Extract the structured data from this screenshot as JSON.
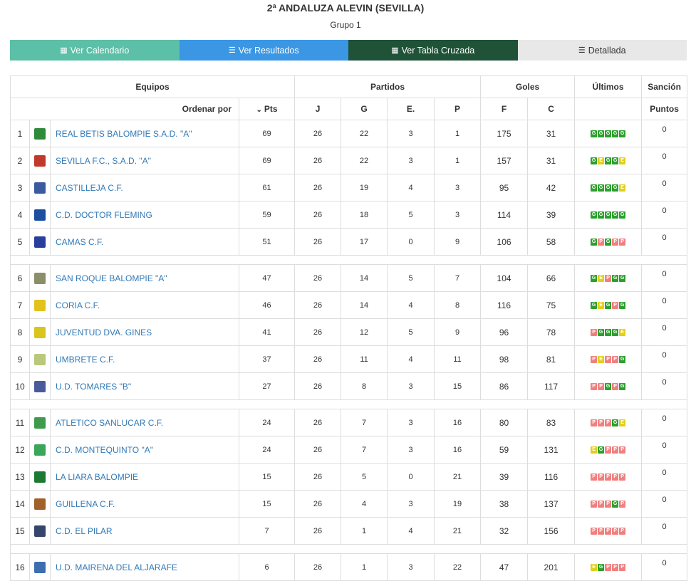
{
  "header": {
    "title": "2ª ANDALUZA ALEVIN (SEVILLA)",
    "subtitle": "Grupo 1"
  },
  "buttons": [
    {
      "label": "Ver Calendario",
      "icon": "calendar-icon",
      "color": "#5cbfa7",
      "text": "#ffffff"
    },
    {
      "label": "Ver Resultados",
      "icon": "list-icon",
      "color": "#3b97e3",
      "text": "#ffffff"
    },
    {
      "label": "Ver Tabla Cruzada",
      "icon": "grid-icon",
      "color": "#1f5237",
      "text": "#ffffff"
    },
    {
      "label": "Detallada",
      "icon": "detail-list-icon",
      "color": "#e8e8e8",
      "text": "#333333"
    }
  ],
  "table": {
    "head1": {
      "equipos": "Equipos",
      "partidos": "Partidos",
      "goles": "Goles",
      "ultimos": "Últimos",
      "sancion": "Sanción"
    },
    "head2": {
      "ordenar": "Ordenar por",
      "pts": "Pts",
      "j": "J",
      "g": "G",
      "e": "E.",
      "p": "P",
      "f": "F",
      "c": "C",
      "puntos": "Puntos"
    },
    "rows": [
      {
        "pos": "1",
        "name": "REAL BETIS BALOMPIE S.A.D. \"A\"",
        "crest": "#2e8b3a",
        "pts": "69",
        "j": "26",
        "g": "22",
        "e": "3",
        "p": "1",
        "f": "175",
        "c": "31",
        "form": [
          "G",
          "G",
          "G",
          "G",
          "G"
        ],
        "sancion": "0"
      },
      {
        "pos": "2",
        "name": "SEVILLA F.C., S.A.D. \"A\"",
        "crest": "#c0392b",
        "pts": "69",
        "j": "26",
        "g": "22",
        "e": "3",
        "p": "1",
        "f": "157",
        "c": "31",
        "form": [
          "G",
          "E",
          "G",
          "G",
          "E"
        ],
        "sancion": "0"
      },
      {
        "pos": "3",
        "name": "CASTILLEJA C.F.",
        "crest": "#3b5aa0",
        "pts": "61",
        "j": "26",
        "g": "19",
        "e": "4",
        "p": "3",
        "f": "95",
        "c": "42",
        "form": [
          "G",
          "G",
          "G",
          "G",
          "E"
        ],
        "sancion": "0"
      },
      {
        "pos": "4",
        "name": "C.D. DOCTOR FLEMING",
        "crest": "#1d4ea0",
        "pts": "59",
        "j": "26",
        "g": "18",
        "e": "5",
        "p": "3",
        "f": "114",
        "c": "39",
        "form": [
          "G",
          "G",
          "G",
          "G",
          "G"
        ],
        "sancion": "0"
      },
      {
        "pos": "5",
        "name": "CAMAS C.F.",
        "crest": "#2a3f9c",
        "pts": "51",
        "j": "26",
        "g": "17",
        "e": "0",
        "p": "9",
        "f": "106",
        "c": "58",
        "form": [
          "G",
          "P",
          "G",
          "P",
          "P"
        ],
        "sancion": "0"
      },
      {
        "sep": true
      },
      {
        "pos": "6",
        "name": "SAN ROQUE BALOMPIE \"A\"",
        "crest": "#8a8f6a",
        "pts": "47",
        "j": "26",
        "g": "14",
        "e": "5",
        "p": "7",
        "f": "104",
        "c": "66",
        "form": [
          "G",
          "E",
          "P",
          "G",
          "G"
        ],
        "sancion": "0"
      },
      {
        "pos": "7",
        "name": "CORIA C.F.",
        "crest": "#e3c21d",
        "pts": "46",
        "j": "26",
        "g": "14",
        "e": "4",
        "p": "8",
        "f": "116",
        "c": "75",
        "form": [
          "G",
          "E",
          "G",
          "P",
          "G"
        ],
        "sancion": "0"
      },
      {
        "pos": "8",
        "name": "JUVENTUD DVA. GINES",
        "crest": "#d9c51b",
        "pts": "41",
        "j": "26",
        "g": "12",
        "e": "5",
        "p": "9",
        "f": "96",
        "c": "78",
        "form": [
          "P",
          "G",
          "G",
          "G",
          "E"
        ],
        "sancion": "0"
      },
      {
        "pos": "9",
        "name": "UMBRETE C.F.",
        "crest": "#b9c87a",
        "pts": "37",
        "j": "26",
        "g": "11",
        "e": "4",
        "p": "11",
        "f": "98",
        "c": "81",
        "form": [
          "P",
          "E",
          "P",
          "P",
          "G"
        ],
        "sancion": "0"
      },
      {
        "pos": "10",
        "name": "U.D. TOMARES \"B\"",
        "crest": "#4a5b9c",
        "pts": "27",
        "j": "26",
        "g": "8",
        "e": "3",
        "p": "15",
        "f": "86",
        "c": "117",
        "form": [
          "P",
          "P",
          "G",
          "P",
          "G"
        ],
        "sancion": "0"
      },
      {
        "sep": true
      },
      {
        "pos": "11",
        "name": "ATLETICO SANLUCAR C.F.",
        "crest": "#3f9a4b",
        "pts": "24",
        "j": "26",
        "g": "7",
        "e": "3",
        "p": "16",
        "f": "80",
        "c": "83",
        "form": [
          "P",
          "P",
          "P",
          "G",
          "E"
        ],
        "sancion": "0"
      },
      {
        "pos": "12",
        "name": "C.D. MONTEQUINTO \"A\"",
        "crest": "#39a659",
        "pts": "24",
        "j": "26",
        "g": "7",
        "e": "3",
        "p": "16",
        "f": "59",
        "c": "131",
        "form": [
          "E",
          "G",
          "P",
          "P",
          "P"
        ],
        "sancion": "0"
      },
      {
        "pos": "13",
        "name": "LA LIARA BALOMPIE",
        "crest": "#1d7a34",
        "pts": "15",
        "j": "26",
        "g": "5",
        "e": "0",
        "p": "21",
        "f": "39",
        "c": "116",
        "form": [
          "P",
          "P",
          "P",
          "P",
          "P"
        ],
        "sancion": "0"
      },
      {
        "pos": "14",
        "name": "GUILLENA C.F.",
        "crest": "#a0622a",
        "pts": "15",
        "j": "26",
        "g": "4",
        "e": "3",
        "p": "19",
        "f": "38",
        "c": "137",
        "form": [
          "P",
          "P",
          "P",
          "G",
          "P"
        ],
        "sancion": "0"
      },
      {
        "pos": "15",
        "name": "C.D. EL PILAR",
        "crest": "#36456b",
        "pts": "7",
        "j": "26",
        "g": "1",
        "e": "4",
        "p": "21",
        "f": "32",
        "c": "156",
        "form": [
          "P",
          "P",
          "P",
          "P",
          "P"
        ],
        "sancion": "0"
      },
      {
        "sep": true
      },
      {
        "pos": "16",
        "name": "U.D. MAIRENA DEL ALJARAFE",
        "crest": "#3d6fb0",
        "pts": "6",
        "j": "26",
        "g": "1",
        "e": "3",
        "p": "22",
        "f": "47",
        "c": "201",
        "form": [
          "E",
          "G",
          "P",
          "P",
          "P"
        ],
        "sancion": "0"
      }
    ]
  }
}
